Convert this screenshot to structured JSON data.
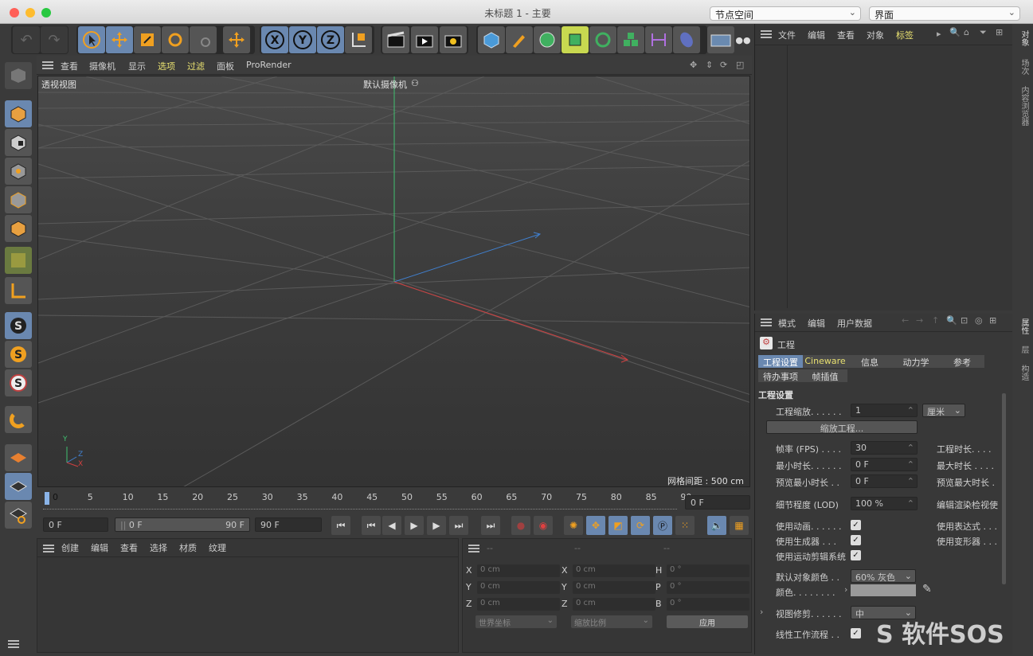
{
  "window": {
    "title": "未标题 1 - 主要",
    "node_space": "节点空间",
    "layout": "界面"
  },
  "viewport_menu": {
    "items": [
      "查看",
      "摄像机",
      "显示",
      "选项",
      "过滤",
      "面板",
      "ProRender"
    ]
  },
  "viewport": {
    "view_name": "透视视图",
    "camera": "默认摄像机",
    "grid_spacing": "网格间距 : 500 cm",
    "axis_y": "Y",
    "axis_z": "Z",
    "axis_x": "X"
  },
  "timeline": {
    "ticks": [
      "0",
      "5",
      "10",
      "15",
      "20",
      "25",
      "30",
      "35",
      "40",
      "45",
      "50",
      "55",
      "60",
      "65",
      "70",
      "75",
      "80",
      "85",
      "90"
    ],
    "current": "0 F"
  },
  "transport": {
    "start": "0 F",
    "range_start": "0 F",
    "range_end": "90 F",
    "end": "90 F"
  },
  "material_menu": [
    "创建",
    "编辑",
    "查看",
    "选择",
    "材质",
    "纹理"
  ],
  "coords": {
    "dash": "--",
    "rows": [
      {
        "a": "X",
        "av": "0 cm",
        "b": "X",
        "bv": "0 cm",
        "c": "H",
        "cv": "0 °"
      },
      {
        "a": "Y",
        "av": "0 cm",
        "b": "Y",
        "bv": "0 cm",
        "c": "P",
        "cv": "0 °"
      },
      {
        "a": "Z",
        "av": "0 cm",
        "b": "Z",
        "bv": "0 cm",
        "c": "B",
        "cv": "0 °"
      }
    ],
    "world": "世界坐标",
    "scale": "缩放比例",
    "apply": "应用"
  },
  "object_menu": [
    "文件",
    "编辑",
    "查看",
    "对象",
    "标签"
  ],
  "right_tabs": {
    "top": [
      "对象",
      "场次",
      "内容浏览器"
    ],
    "bottom": [
      "属性",
      "层",
      "构造"
    ]
  },
  "attr_menu": [
    "模式",
    "编辑",
    "用户数据"
  ],
  "attr": {
    "header": "工程",
    "tabs1": [
      "工程设置",
      "Cineware",
      "信息",
      "动力学",
      "参考"
    ],
    "tabs2": [
      "待办事项",
      "帧插值"
    ],
    "section": "工程设置",
    "scale_label": "工程缩放. . . . . .",
    "scale_value": "1",
    "scale_unit": "厘米",
    "scale_button": "缩放工程...",
    "fps_label": "帧率 (FPS) . . . .",
    "fps_value": "30",
    "proj_len": "工程时长. . . .",
    "min_label": "最小时长. . . . . .",
    "min_value": "0 F",
    "max_label": "最大时长 . . . .",
    "pmin_label": "预览最小时长 . .",
    "pmin_value": "0 F",
    "pmax_label": "预览最大时长 .",
    "lod_label": "细节程度 (LOD)",
    "lod_value": "100 %",
    "lod_right": "编辑渲染检视使",
    "anim_label": "使用动画. . . . . .",
    "expr_label": "使用表达式 . . .",
    "gen_label": "使用生成器 . . .",
    "def_label": "使用变形器 . . .",
    "motion_label": "使用运动剪辑系统",
    "color_label": "默认对象颜色 . .",
    "color_value": "60% 灰色",
    "col_label": "颜色. . . . . . . .",
    "view_label": "视图修剪. . . . . .",
    "view_value": "中",
    "linear_label": "线性工作流程 . ."
  },
  "watermark": "软件SOS",
  "colors": {
    "accent": "#8ab4e8",
    "yellow_menu": "#e8e070",
    "axis_x": "#d04040",
    "axis_y": "#40c070",
    "axis_z": "#4080d0"
  }
}
